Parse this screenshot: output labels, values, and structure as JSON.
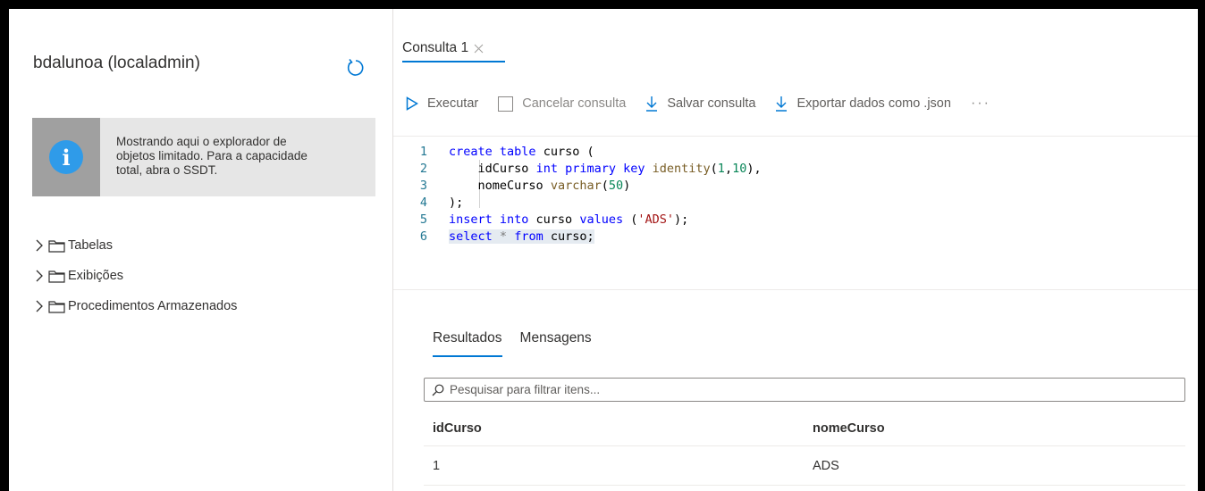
{
  "explorer": {
    "db_title": "bdalunoa (localadmin)",
    "info_icon_text": "i",
    "info_line1": "Mostrando aqui o explorador de",
    "info_line2": "objetos limitado. Para a capacidade",
    "info_line3": "total, abra o SSDT.",
    "tree": [
      {
        "label": "Tabelas",
        "icon": "folder-icon"
      },
      {
        "label": "Exibições",
        "icon": "folder-icon"
      },
      {
        "label": "Procedimentos Armazenados",
        "icon": "folder-icon"
      }
    ]
  },
  "tab": {
    "label": "Consulta 1"
  },
  "toolbar": {
    "run": "Executar",
    "cancel": "Cancelar consulta",
    "save": "Salvar consulta",
    "export": "Exportar dados como .json",
    "more": "···"
  },
  "editor": {
    "line_numbers": [
      "1",
      "2",
      "3",
      "4",
      "5",
      "6"
    ],
    "l1": {
      "kw1": "create table",
      "id": "curso",
      "p": "("
    },
    "l2": {
      "id": "idCurso",
      "kw": "int primary key",
      "fn": "identity",
      "p1": "(",
      "n1": "1",
      "c": ",",
      "n2": "10",
      "p2": "),"
    },
    "l3": {
      "id": "nomeCurso",
      "fn": "varchar",
      "p1": "(",
      "n": "50",
      "p2": ")"
    },
    "l4": {
      "p": ");"
    },
    "l5": {
      "kw1": "insert into",
      "id": "curso",
      "kw2": "values",
      "p1": "(",
      "s": "'ADS'",
      "p2": ");"
    },
    "l6": {
      "kw1": "select",
      "star": "*",
      "kw2": "from",
      "id": "curso;"
    }
  },
  "results": {
    "tabs": [
      "Resultados",
      "Mensagens"
    ],
    "search_placeholder": "Pesquisar para filtrar itens...",
    "columns": [
      "idCurso",
      "nomeCurso"
    ],
    "rows": [
      [
        "1",
        "ADS"
      ]
    ]
  },
  "colors": {
    "accent": "#0078d4",
    "info": "#2f9be9"
  }
}
